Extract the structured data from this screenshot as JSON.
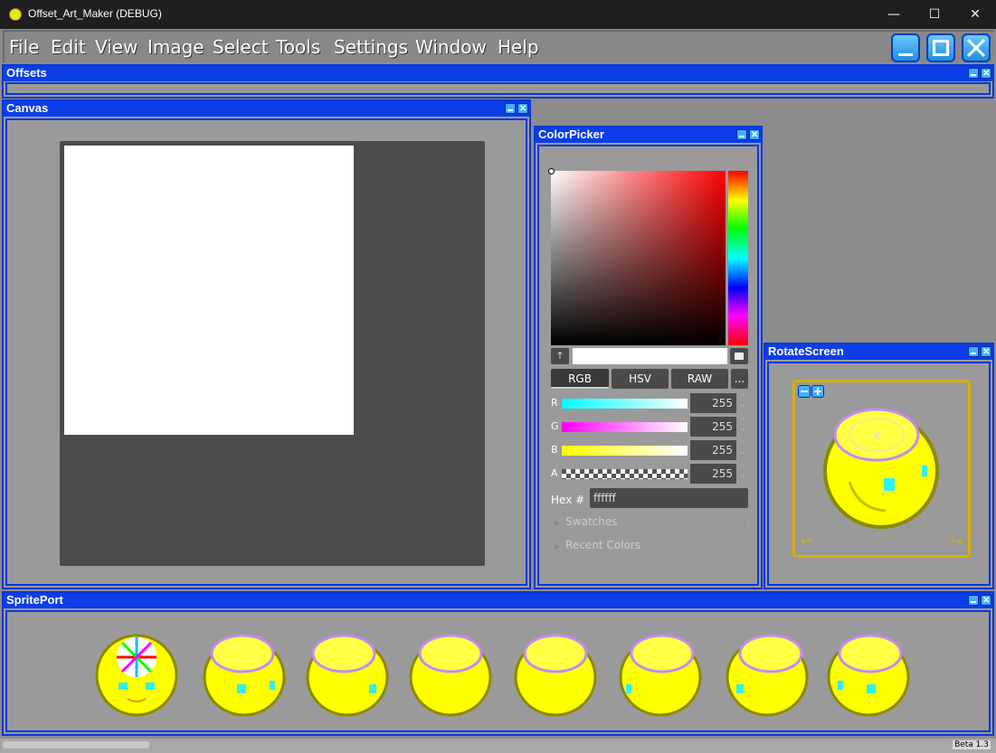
{
  "window": {
    "title": "Offset_Art_Maker (DEBUG)",
    "min_glyph": "—",
    "max_glyph": "☐",
    "close_glyph": "✕"
  },
  "menu": {
    "items": [
      "File",
      "Edit",
      "View",
      "Image",
      "Select",
      "Tools",
      "Settings",
      "Window",
      "Help"
    ]
  },
  "panels": {
    "offsets": "Offsets",
    "canvas": "Canvas",
    "colorpicker": "ColorPicker",
    "rotatescreen": "RotateScreen",
    "spriteport": "SpritePort"
  },
  "colorpicker": {
    "eyedropper_glyph": "↑",
    "tabs": [
      "RGB",
      "HSV",
      "RAW",
      "..."
    ],
    "channels": [
      {
        "label": "R",
        "value": "255"
      },
      {
        "label": "G",
        "value": "255"
      },
      {
        "label": "B",
        "value": "255"
      },
      {
        "label": "A",
        "value": "255"
      }
    ],
    "hex_label": "Hex  #",
    "hex_value": "ffffff",
    "swatches": "Swatches",
    "recent": "Recent Colors",
    "spin_up": "⌃",
    "spin_down": "⌄"
  },
  "status": {
    "version": "Beta 1.3"
  },
  "colors": {
    "panel_border": "#0a37d8",
    "accent": "#0b3ee6",
    "sprite_yellow": "#ffff00",
    "frame_gold": "#d8b000"
  }
}
